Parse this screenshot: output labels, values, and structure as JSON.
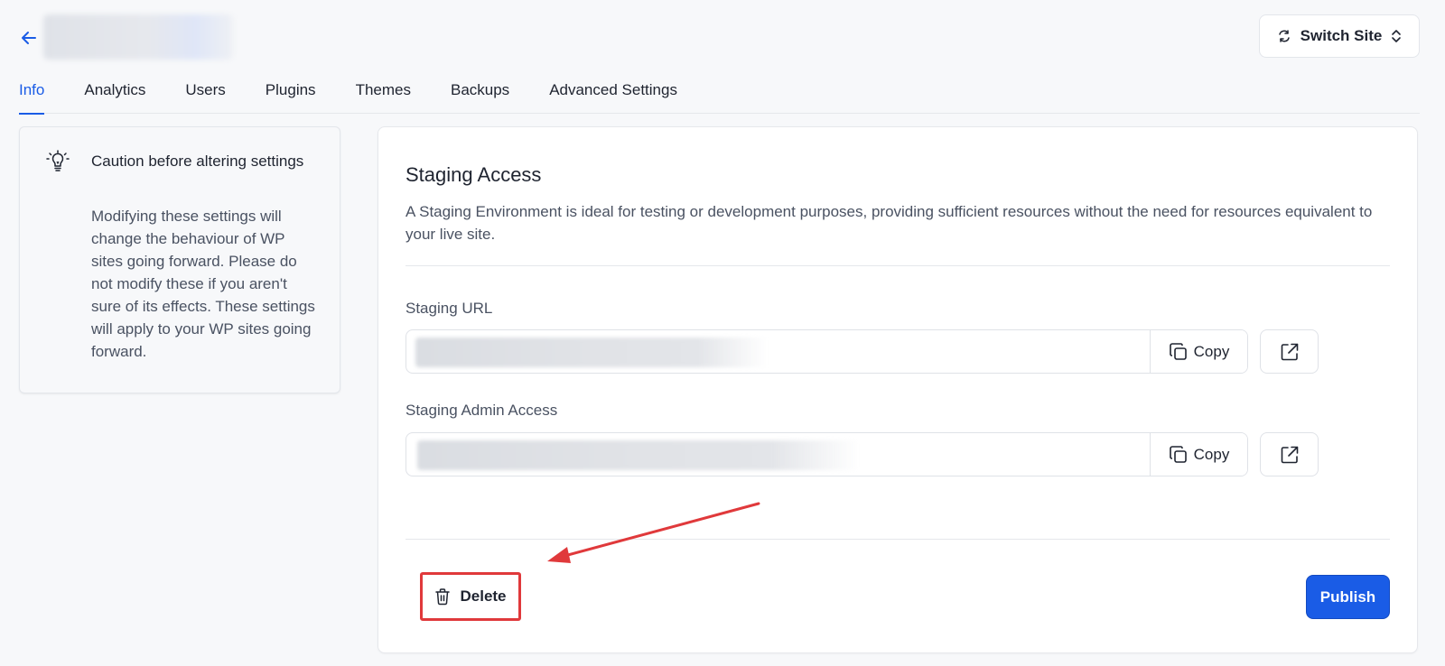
{
  "header": {
    "switch_site_label": "Switch Site"
  },
  "tabs": [
    {
      "label": "Info",
      "active": true
    },
    {
      "label": "Analytics"
    },
    {
      "label": "Users"
    },
    {
      "label": "Plugins"
    },
    {
      "label": "Themes"
    },
    {
      "label": "Backups"
    },
    {
      "label": "Advanced Settings"
    }
  ],
  "caution": {
    "title": "Caution before altering settings",
    "body": "Modifying these settings will change the behaviour of WP sites going forward. Please do not modify these if you aren't sure of its effects. These settings will apply to your WP sites going forward."
  },
  "staging": {
    "title": "Staging Access",
    "description": "A Staging Environment is ideal for testing or development purposes, providing sufficient resources without the need for resources equivalent to your live site.",
    "url_label": "Staging URL",
    "admin_label": "Staging Admin Access",
    "copy_label": "Copy",
    "delete_label": "Delete",
    "publish_label": "Publish"
  },
  "colors": {
    "accent": "#1a5ce6",
    "annotation": "#e0393b"
  }
}
